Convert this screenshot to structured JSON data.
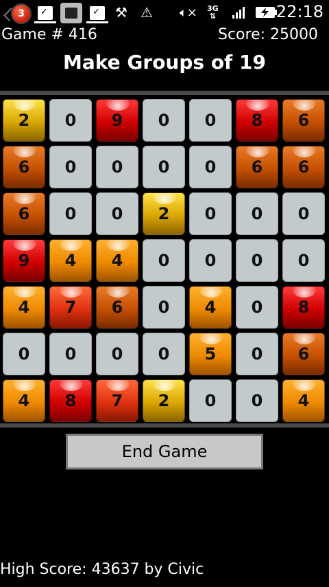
{
  "status_bar": {
    "notification_count": "3",
    "network_type": "3G",
    "time": "22:18",
    "icons": [
      "notification-badge-icon",
      "download-complete-icon",
      "shopping-bag-icon",
      "download-complete-icon",
      "usb-debug-icon",
      "warning-icon",
      "mute-icon",
      "network-3g-icon",
      "signal-icon",
      "battery-charging-icon"
    ]
  },
  "header": {
    "game_label": "Game # 416",
    "score_label": "Score: 25000",
    "title": "Make Groups of 19"
  },
  "colors": {
    "yellow": "#e0b000",
    "orange": "#ee8a00",
    "dark_orange": "#c85000",
    "red_orange": "#e03010",
    "red": "#d00000",
    "empty": "#c3cacc"
  },
  "board": {
    "rows": [
      [
        {
          "v": "2",
          "c": "yellow"
        },
        {
          "v": "0",
          "c": "empty"
        },
        {
          "v": "9",
          "c": "red"
        },
        {
          "v": "0",
          "c": "empty"
        },
        {
          "v": "0",
          "c": "empty"
        },
        {
          "v": "8",
          "c": "red"
        },
        {
          "v": "6",
          "c": "dark_orange"
        }
      ],
      [
        {
          "v": "6",
          "c": "dark_orange"
        },
        {
          "v": "0",
          "c": "empty"
        },
        {
          "v": "0",
          "c": "empty"
        },
        {
          "v": "0",
          "c": "empty"
        },
        {
          "v": "0",
          "c": "empty"
        },
        {
          "v": "6",
          "c": "dark_orange"
        },
        {
          "v": "6",
          "c": "dark_orange"
        }
      ],
      [
        {
          "v": "6",
          "c": "dark_orange"
        },
        {
          "v": "0",
          "c": "empty"
        },
        {
          "v": "0",
          "c": "empty"
        },
        {
          "v": "2",
          "c": "yellow"
        },
        {
          "v": "0",
          "c": "empty"
        },
        {
          "v": "0",
          "c": "empty"
        },
        {
          "v": "0",
          "c": "empty"
        }
      ],
      [
        {
          "v": "9",
          "c": "red"
        },
        {
          "v": "4",
          "c": "orange"
        },
        {
          "v": "4",
          "c": "orange"
        },
        {
          "v": "0",
          "c": "empty"
        },
        {
          "v": "0",
          "c": "empty"
        },
        {
          "v": "0",
          "c": "empty"
        },
        {
          "v": "0",
          "c": "empty"
        }
      ],
      [
        {
          "v": "4",
          "c": "orange"
        },
        {
          "v": "7",
          "c": "red_orange"
        },
        {
          "v": "6",
          "c": "dark_orange"
        },
        {
          "v": "0",
          "c": "empty"
        },
        {
          "v": "4",
          "c": "orange"
        },
        {
          "v": "0",
          "c": "empty"
        },
        {
          "v": "8",
          "c": "red"
        }
      ],
      [
        {
          "v": "0",
          "c": "empty"
        },
        {
          "v": "0",
          "c": "empty"
        },
        {
          "v": "0",
          "c": "empty"
        },
        {
          "v": "0",
          "c": "empty"
        },
        {
          "v": "5",
          "c": "orange"
        },
        {
          "v": "0",
          "c": "empty"
        },
        {
          "v": "6",
          "c": "dark_orange"
        }
      ],
      [
        {
          "v": "4",
          "c": "orange"
        },
        {
          "v": "8",
          "c": "red"
        },
        {
          "v": "7",
          "c": "red_orange"
        },
        {
          "v": "2",
          "c": "yellow"
        },
        {
          "v": "0",
          "c": "empty"
        },
        {
          "v": "0",
          "c": "empty"
        },
        {
          "v": "4",
          "c": "orange"
        }
      ]
    ]
  },
  "end_game_label": "End Game",
  "high_score_label": "High Score: 43637 by Civic"
}
